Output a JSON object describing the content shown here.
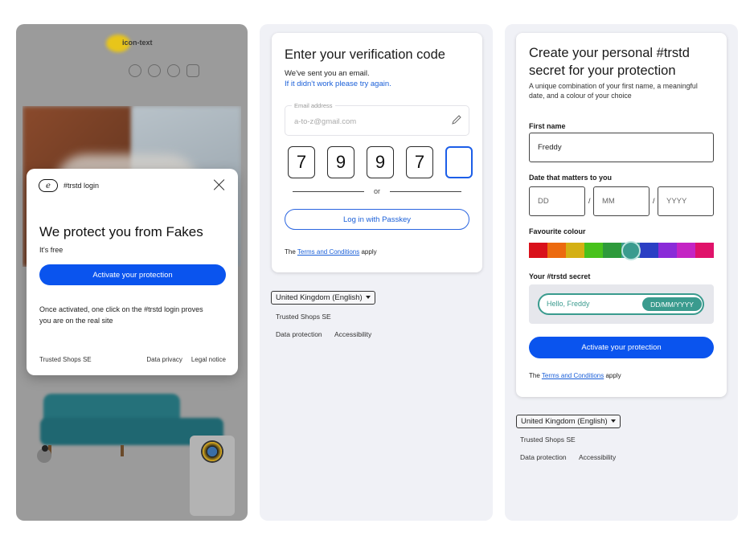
{
  "colors": {
    "primary_blue": "#0a54ee",
    "link_blue": "#1a5fd8",
    "teal": "#3a9b8e",
    "panel_bg": "#f0f1f6"
  },
  "panel1": {
    "shop_logo": "icon-text",
    "modal": {
      "brand_label": "#trstd login",
      "brand_icon_letter": "e",
      "heading": "We protect you from Fakes",
      "subheading": "It's free",
      "activate_button": "Activate your protection",
      "body": "Once activated, one click on the #trstd login proves you are on the real site",
      "footer_left": "Trusted Shops SE",
      "footer_links": [
        "Data privacy",
        "Legal notice"
      ]
    }
  },
  "panel2": {
    "title": "Enter your verification code",
    "sent_text": "We've sent you an email.",
    "retry_link": "If it didn't work please try again.",
    "email_label": "Email address",
    "email_value": "a-to-z@gmail.com",
    "code_digits": [
      "7",
      "9",
      "9",
      "7",
      ""
    ],
    "or_text": "or",
    "passkey_button": "Log in with Passkey",
    "terms_prefix": "The",
    "terms_link": "Terms and Conditions",
    "terms_suffix": "apply",
    "language": "United Kingdom (English)",
    "footer_company": "Trusted Shops SE",
    "footer_links": [
      "Data protection",
      "Accessibility"
    ]
  },
  "panel3": {
    "title": "Create your personal #trstd secret for your protection",
    "description": "A unique combination of your first name, a meaningful date, and a colour of your choice",
    "first_name_label": "First name",
    "first_name_value": "Freddy",
    "date_label": "Date that matters to you",
    "date_placeholders": [
      "DD",
      "MM",
      "YYYY"
    ],
    "date_separator": "/",
    "colour_label": "Favourite colour",
    "colours": [
      "#d9101a",
      "#ec6a0f",
      "#d4b014",
      "#48c21c",
      "#2e9a3b",
      "#3a9b8e",
      "#2b3fc4",
      "#8a2bd8",
      "#c424c4",
      "#e0126a"
    ],
    "selected_colour": "#3a9b8e",
    "secret_label": "Your #trstd secret",
    "secret_greeting": "Hello, Freddy",
    "secret_date": "DD/MM/YYYY",
    "activate_button": "Activate your protection",
    "terms_prefix": "The",
    "terms_link": "Terms and Conditions",
    "terms_suffix": "apply",
    "language": "United Kingdom (English)",
    "footer_company": "Trusted Shops SE",
    "footer_links": [
      "Data protection",
      "Accessibility"
    ]
  }
}
